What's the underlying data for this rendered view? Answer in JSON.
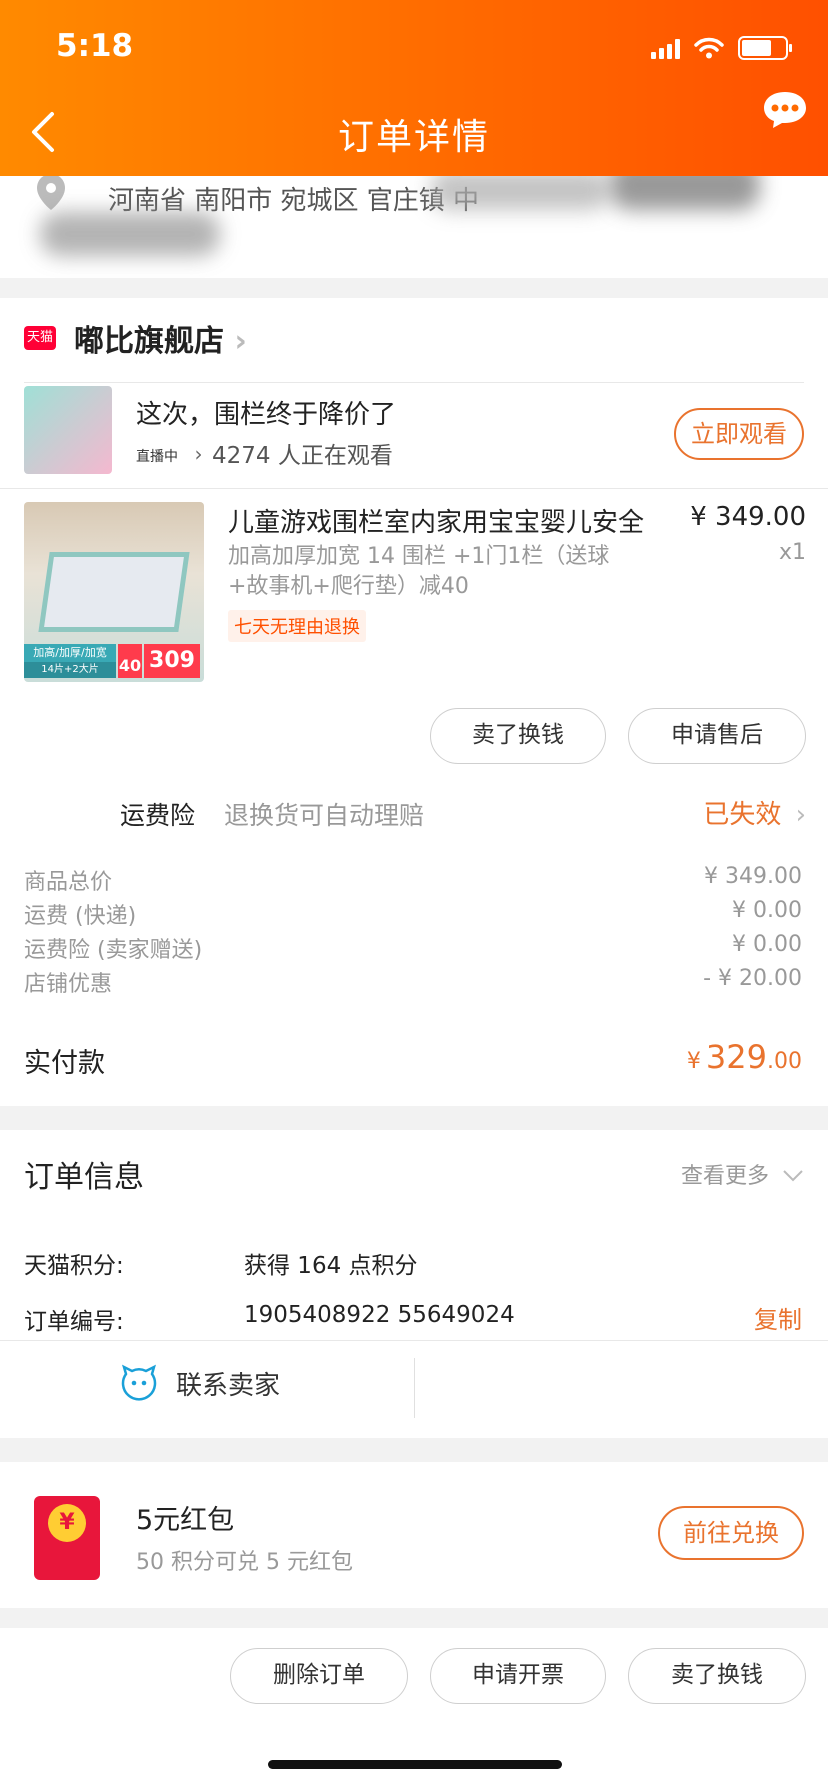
{
  "status_bar": {
    "time": "5:18"
  },
  "nav": {
    "title": "订单详情"
  },
  "address": {
    "text": "河南省 南阳市 宛城区 官庄镇 中"
  },
  "store": {
    "badge": "天猫",
    "name": "嘟比旗舰店",
    "chevron": "›"
  },
  "live": {
    "title": "这次，围栏终于降价了",
    "tag": "直播中",
    "tag_arrow": "›",
    "viewers": "4274 人正在观看",
    "button": "立即观看"
  },
  "product": {
    "title": "儿童游戏围栏室内家用宝宝婴儿安全",
    "price": "¥ 349.00",
    "quantity": "x1",
    "spec": "加高加厚加宽 14 围栏 +1门1栏（送球+故事机+爬行垫）减40",
    "return_policy": "七天无理由退换",
    "img_tag": "加高/加厚/加宽",
    "img_sub": "14片+2大片",
    "img_price_40": "40",
    "img_price_309": "309",
    "sell_button": "卖了换钱",
    "aftersale_button": "申请售后"
  },
  "insurance": {
    "label": "运费险",
    "desc": "退换货可自动理赔",
    "status": "已失效"
  },
  "fees": [
    {
      "label": "商品总价",
      "value": "¥ 349.00"
    },
    {
      "label": "运费 (快递)",
      "value": "¥ 0.00"
    },
    {
      "label": "运费险 (卖家赠送)",
      "value": "¥ 0.00"
    },
    {
      "label": "店铺优惠",
      "value": "- ¥ 20.00"
    }
  ],
  "paid": {
    "label": "实付款",
    "currency": "¥",
    "integer": "329",
    "decimal": ".00"
  },
  "order_info": {
    "title": "订单信息",
    "more": "查看更多",
    "points_key": "天猫积分:",
    "points_val": "获得 164 点积分",
    "order_no_key": "订单编号:",
    "order_no_val": "1905408922 55649024",
    "copy": "复制",
    "contact": "联系卖家"
  },
  "redpack": {
    "title": "5元红包",
    "sub": "50 积分可兑 5 元红包",
    "button": "前往兑换"
  },
  "footer": {
    "delete": "删除订单",
    "invoice": "申请开票",
    "sell": "卖了换钱"
  },
  "colors": {
    "accent": "#e9732e",
    "header_start": "#ff8a00",
    "header_end": "#ff5000"
  }
}
